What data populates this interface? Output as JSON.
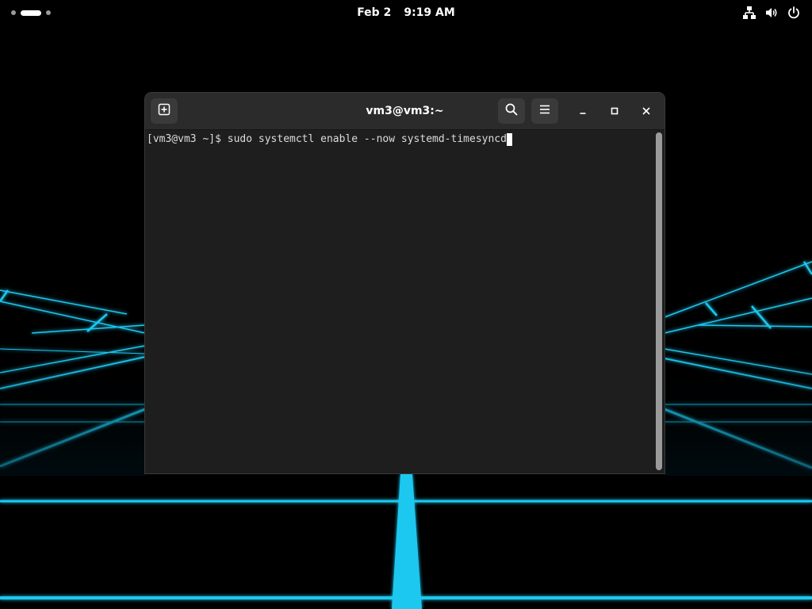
{
  "topbar": {
    "date": "Feb 2",
    "time": "9:19 AM",
    "tray_icons": [
      "network-icon",
      "volume-icon",
      "power-icon"
    ]
  },
  "terminal": {
    "title": "vm3@vm3:~",
    "prompt": "[vm3@vm3 ~]$ ",
    "command": "sudo systemctl enable --now systemd-timesyncd"
  },
  "colors": {
    "accent_neon": "#1ec8f0",
    "headerbar": "#2b2b2b",
    "terminal_bg": "#1e1e1e"
  }
}
